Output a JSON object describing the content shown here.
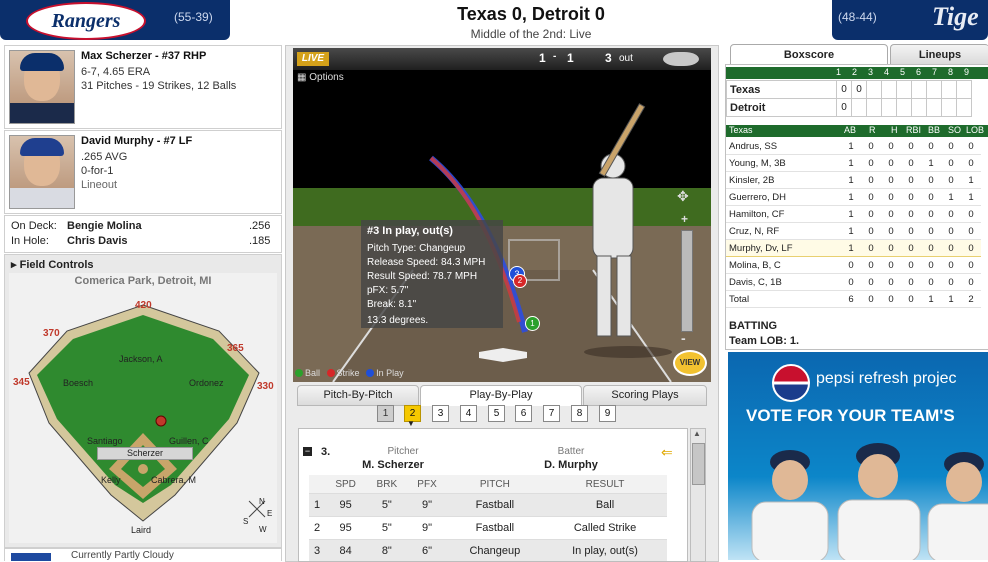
{
  "header": {
    "away_record": "(55-39)",
    "home_record": "(48-44)",
    "away_logo": "Rangers",
    "home_logo": "Tige",
    "score_title": "Texas 0, Detroit 0",
    "status": "Middle of the 2nd: Live"
  },
  "pitcher": {
    "name": "Max Scherzer - #37 RHP",
    "record": "6-7, 4.65 ERA",
    "pitches": "31 Pitches - 19 Strikes, 12 Balls"
  },
  "batter": {
    "name": "David Murphy - #7 LF",
    "avg": ".265 AVG",
    "today": "0-for-1",
    "result": "Lineout"
  },
  "ondeck": {
    "on_deck_label": "On Deck:",
    "on_deck_name": "Bengie Molina",
    "on_deck_avg": ".256",
    "in_hole_label": "In Hole:",
    "in_hole_name": "Chris Davis",
    "in_hole_avg": ".185"
  },
  "field": {
    "title": "Field Controls",
    "park": "Comerica Park, Detroit, MI",
    "dist_cf": "420",
    "dist_lcf": "370",
    "dist_rcf": "365",
    "dist_lf": "345",
    "dist_rf": "330",
    "cf": "Jackson, A",
    "lf": "Boesch",
    "rf": "Ordonez",
    "ss": "Santiago",
    "second": "Guillen, C",
    "pitcher": "Scherzer",
    "third": "Kelly",
    "first": "Cabrera, M",
    "catcher": "Laird",
    "compass": [
      "N",
      "E",
      "S",
      "W"
    ]
  },
  "weather": {
    "text": "Currently  Partly Cloudy"
  },
  "gamecast": {
    "live_label": "LIVE",
    "count_balls": "1",
    "count_sep": "-",
    "count_strikes": "1",
    "outs": "3",
    "outs_label": "out",
    "options_label": "Options",
    "tooltip": {
      "title": "#3 In play, out(s)",
      "pitch_type": "Pitch Type: Changeup",
      "release": "Release Speed: 84.3 MPH",
      "result_speed": "Result Speed: 78.7 MPH",
      "pfx": "pFX: 5.7\"",
      "break": "Break: 8.1\"",
      "degrees": "13.3 degrees."
    },
    "legend_ball": "Ball",
    "legend_strike": "Strike",
    "legend_inplay": "In Play",
    "view_label": "VIEW",
    "pitch_markers": [
      "3",
      "2",
      "1"
    ],
    "colors": {
      "ball": "#2ca02c",
      "strike": "#d62728",
      "inplay": "#1f4fd8",
      "live": "#d4a11a"
    }
  },
  "tabs": {
    "pitch_by_pitch": "Pitch-By-Pitch",
    "play_by_play": "Play-By-Play",
    "scoring_plays": "Scoring Plays"
  },
  "innings": [
    "1",
    "2",
    "3",
    "4",
    "5",
    "6",
    "7",
    "8",
    "9"
  ],
  "pbp": {
    "atbat_num": "3.",
    "pitcher_label": "Pitcher",
    "pitcher_name": "M. Scherzer",
    "batter_label": "Batter",
    "batter_name": "D. Murphy",
    "columns": [
      "SPD",
      "BRK",
      "PFX",
      "PITCH",
      "RESULT"
    ],
    "rows": [
      {
        "n": "1",
        "spd": "95",
        "brk": "5\"",
        "pfx": "9\"",
        "pitch": "Fastball",
        "result": "Ball"
      },
      {
        "n": "2",
        "spd": "95",
        "brk": "5\"",
        "pfx": "9\"",
        "pitch": "Fastball",
        "result": "Called Strike"
      },
      {
        "n": "3",
        "spd": "84",
        "brk": "8\"",
        "pfx": "6\"",
        "pitch": "Changeup",
        "result": "In play, out(s)"
      }
    ]
  },
  "boxscore": {
    "tab_box": "Boxscore",
    "tab_lineups": "Lineups",
    "innings": [
      "1",
      "2",
      "3",
      "4",
      "5",
      "6",
      "7",
      "8",
      "9"
    ],
    "line": [
      {
        "team": "Texas",
        "runs": [
          "0",
          "0",
          "",
          "",
          "",
          "",
          "",
          "",
          ""
        ]
      },
      {
        "team": "Detroit",
        "runs": [
          "0",
          "",
          "",
          "",
          "",
          "",
          "",
          "",
          ""
        ]
      }
    ],
    "batting_team": "Texas",
    "columns": [
      "AB",
      "R",
      "H",
      "RBI",
      "BB",
      "SO",
      "LOB"
    ],
    "batters": [
      {
        "name": "Andrus, SS",
        "s": [
          "1",
          "0",
          "0",
          "0",
          "0",
          "0",
          "0"
        ]
      },
      {
        "name": "Young, M, 3B",
        "s": [
          "1",
          "0",
          "0",
          "0",
          "1",
          "0",
          "0"
        ]
      },
      {
        "name": "Kinsler, 2B",
        "s": [
          "1",
          "0",
          "0",
          "0",
          "0",
          "0",
          "1"
        ]
      },
      {
        "name": "Guerrero, DH",
        "s": [
          "1",
          "0",
          "0",
          "0",
          "0",
          "1",
          "1"
        ]
      },
      {
        "name": "Hamilton, CF",
        "s": [
          "1",
          "0",
          "0",
          "0",
          "0",
          "0",
          "0"
        ]
      },
      {
        "name": "Cruz, N, RF",
        "s": [
          "1",
          "0",
          "0",
          "0",
          "0",
          "0",
          "0"
        ]
      },
      {
        "name": "Murphy, Dv, LF",
        "s": [
          "1",
          "0",
          "0",
          "0",
          "0",
          "0",
          "0"
        ]
      },
      {
        "name": "Molina, B, C",
        "s": [
          "0",
          "0",
          "0",
          "0",
          "0",
          "0",
          "0"
        ]
      },
      {
        "name": "Davis, C, 1B",
        "s": [
          "0",
          "0",
          "0",
          "0",
          "0",
          "0",
          "0"
        ]
      },
      {
        "name": "Total",
        "s": [
          "6",
          "0",
          "0",
          "0",
          "1",
          "1",
          "2"
        ]
      }
    ],
    "batting_label": "BATTING",
    "team_lob": "Team LOB: 1."
  },
  "ad": {
    "line1": "pepsi refresh projec",
    "line2": "VOTE FOR YOUR TEAM'S"
  }
}
